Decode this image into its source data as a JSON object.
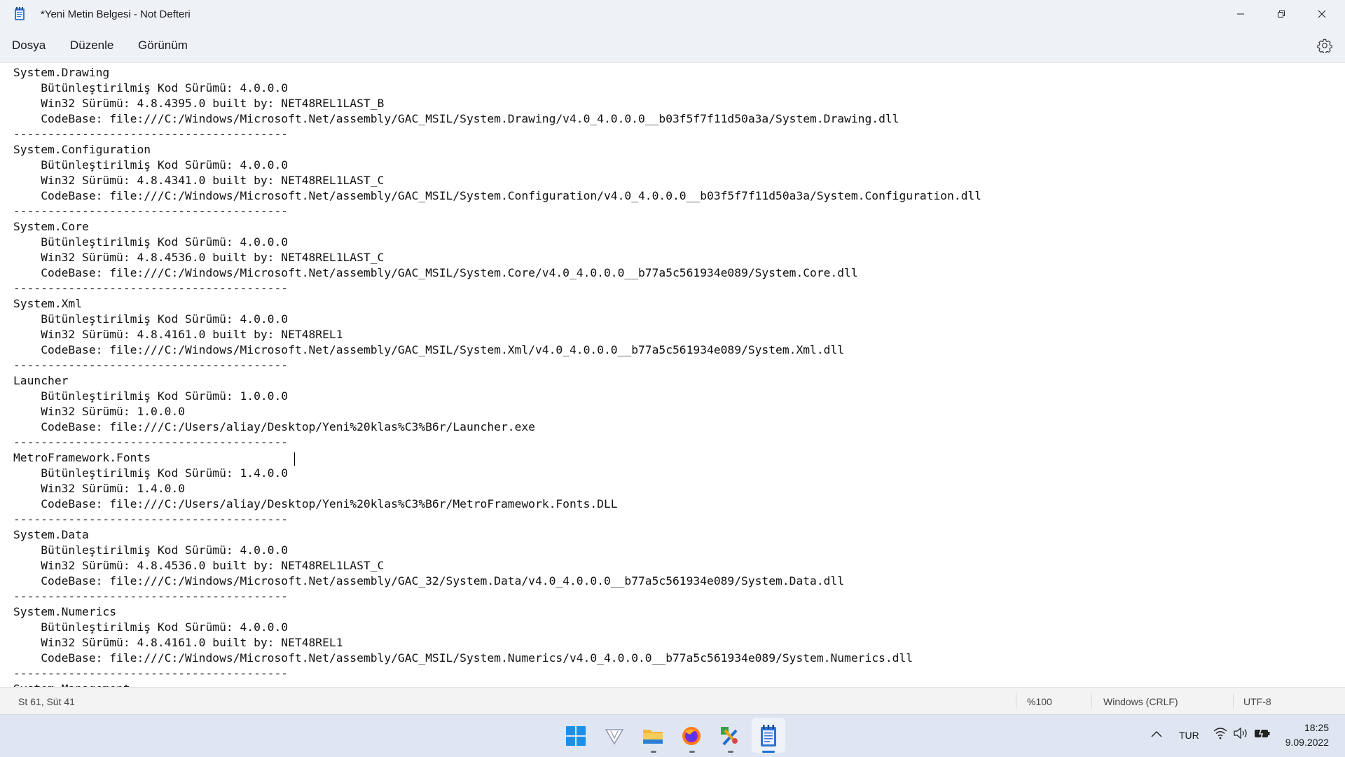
{
  "window": {
    "title": "*Yeni Metin Belgesi - Not Defteri",
    "icon": "notepad-icon",
    "controls": [
      "minimize-icon",
      "restore-icon",
      "close-icon"
    ]
  },
  "menu": {
    "file": "Dosya",
    "edit": "Düzenle",
    "view": "Görünüm",
    "settings_icon": "gear-icon"
  },
  "editor": {
    "lines": [
      "System.Drawing",
      "    Bütünleştirilmiş Kod Sürümü: 4.0.0.0",
      "    Win32 Sürümü: 4.8.4395.0 built by: NET48REL1LAST_B",
      "    CodeBase: file:///C:/Windows/Microsoft.Net/assembly/GAC_MSIL/System.Drawing/v4.0_4.0.0.0__b03f5f7f11d50a3a/System.Drawing.dll",
      "----------------------------------------",
      "System.Configuration",
      "    Bütünleştirilmiş Kod Sürümü: 4.0.0.0",
      "    Win32 Sürümü: 4.8.4341.0 built by: NET48REL1LAST_C",
      "    CodeBase: file:///C:/Windows/Microsoft.Net/assembly/GAC_MSIL/System.Configuration/v4.0_4.0.0.0__b03f5f7f11d50a3a/System.Configuration.dll",
      "----------------------------------------",
      "System.Core",
      "    Bütünleştirilmiş Kod Sürümü: 4.0.0.0",
      "    Win32 Sürümü: 4.8.4536.0 built by: NET48REL1LAST_C",
      "    CodeBase: file:///C:/Windows/Microsoft.Net/assembly/GAC_MSIL/System.Core/v4.0_4.0.0.0__b77a5c561934e089/System.Core.dll",
      "----------------------------------------",
      "System.Xml",
      "    Bütünleştirilmiş Kod Sürümü: 4.0.0.0",
      "    Win32 Sürümü: 4.8.4161.0 built by: NET48REL1",
      "    CodeBase: file:///C:/Windows/Microsoft.Net/assembly/GAC_MSIL/System.Xml/v4.0_4.0.0.0__b77a5c561934e089/System.Xml.dll",
      "----------------------------------------",
      "Launcher",
      "    Bütünleştirilmiş Kod Sürümü: 1.0.0.0",
      "    Win32 Sürümü: 1.0.0.0",
      "    CodeBase: file:///C:/Users/aliay/Desktop/Yeni%20klas%C3%B6r/Launcher.exe",
      "----------------------------------------",
      "MetroFramework.Fonts",
      "    Bütünleştirilmiş Kod Sürümü: 1.4.0.0",
      "    Win32 Sürümü: 1.4.0.0",
      "    CodeBase: file:///C:/Users/aliay/Desktop/Yeni%20klas%C3%B6r/MetroFramework.Fonts.DLL",
      "----------------------------------------",
      "System.Data",
      "    Bütünleştirilmiş Kod Sürümü: 4.0.0.0",
      "    Win32 Sürümü: 4.8.4536.0 built by: NET48REL1LAST_C",
      "    CodeBase: file:///C:/Windows/Microsoft.Net/assembly/GAC_32/System.Data/v4.0_4.0.0.0__b77a5c561934e089/System.Data.dll",
      "----------------------------------------",
      "System.Numerics",
      "    Bütünleştirilmiş Kod Sürümü: 4.0.0.0",
      "    Win32 Sürümü: 4.8.4161.0 built by: NET48REL1",
      "    CodeBase: file:///C:/Windows/Microsoft.Net/assembly/GAC_MSIL/System.Numerics/v4.0_4.0.0.0__b77a5c561934e089/System.Numerics.dll",
      "----------------------------------------",
      "System.Management"
    ]
  },
  "status": {
    "position": "St 61, Süt 41",
    "zoom": "%100",
    "line_ending": "Windows (CRLF)",
    "encoding": "UTF-8"
  },
  "taskbar": {
    "apps": [
      "windows-start-icon",
      "vectorize-app-icon",
      "file-explorer-icon",
      "firefox-icon",
      "tools-app-icon",
      "notepad-taskbar-icon"
    ],
    "active_app": "notepad-taskbar-icon",
    "tray": {
      "chevron_icon": "chevron-up-icon",
      "language": "TUR",
      "icons": [
        "wifi-icon",
        "volume-icon",
        "battery-icon"
      ],
      "time": "18:25",
      "date": "9.09.2022"
    }
  },
  "colors": {
    "titlebar_bg": "#eef1f6",
    "editor_bg": "#ffffff",
    "taskbar_bg": "#dfe6f2",
    "active_indicator": "#1a73d9"
  }
}
